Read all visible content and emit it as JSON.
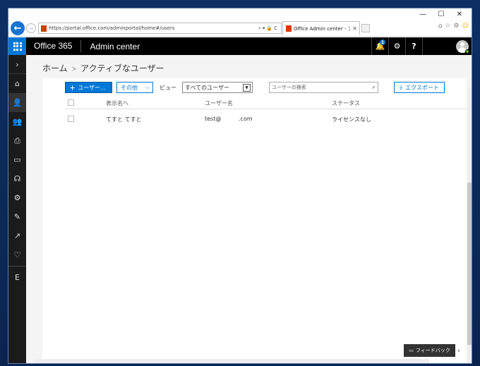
{
  "browser": {
    "url": "https://portal.office.com/adminportal/home#/users",
    "tab_title": "Office Admin center - アクテ...",
    "window_controls": {
      "minimize": "—",
      "maximize": "☐",
      "close": "✕"
    },
    "tools": [
      "⌂",
      "☆",
      "⚙",
      "☺"
    ]
  },
  "o365": {
    "brand": "Office 365",
    "app_name": "Admin center",
    "notification_count": "1",
    "settings_symbol": "⚙",
    "help_symbol": "?"
  },
  "leftnav": {
    "items": [
      {
        "name": "expand-nav",
        "symbol": "›"
      },
      {
        "name": "home",
        "symbol": "⌂"
      },
      {
        "name": "users",
        "symbol": "👤"
      },
      {
        "name": "groups",
        "symbol": "👥"
      },
      {
        "name": "resources",
        "symbol": "⎙"
      },
      {
        "name": "billing",
        "symbol": "▭"
      },
      {
        "name": "support",
        "symbol": "☊"
      },
      {
        "name": "settings",
        "symbol": "⚙"
      },
      {
        "name": "setup",
        "symbol": "✎"
      },
      {
        "name": "reports",
        "symbol": "↗"
      },
      {
        "name": "health",
        "symbol": "♡"
      },
      {
        "name": "exchange",
        "symbol": "E"
      }
    ]
  },
  "breadcrumb": {
    "home": "ホーム",
    "separator": ">",
    "current": "アクティブなユーザー"
  },
  "toolbar": {
    "add_user_label": "ユーザー...",
    "more_label": "その他",
    "view_label": "ビュー",
    "view_selected": "すべてのユーザー",
    "search_placeholder": "ユーザーの検索",
    "export_label": "エクスポート"
  },
  "table": {
    "columns": [
      "表示名へ",
      "ユーザー名",
      "ステータス"
    ],
    "rows": [
      {
        "display_name": "てすと てすと",
        "username_prefix": "test@",
        "username_suffix": ".com",
        "status": "ライセンスなし"
      }
    ]
  },
  "feedback": {
    "label": "フィードバック"
  }
}
